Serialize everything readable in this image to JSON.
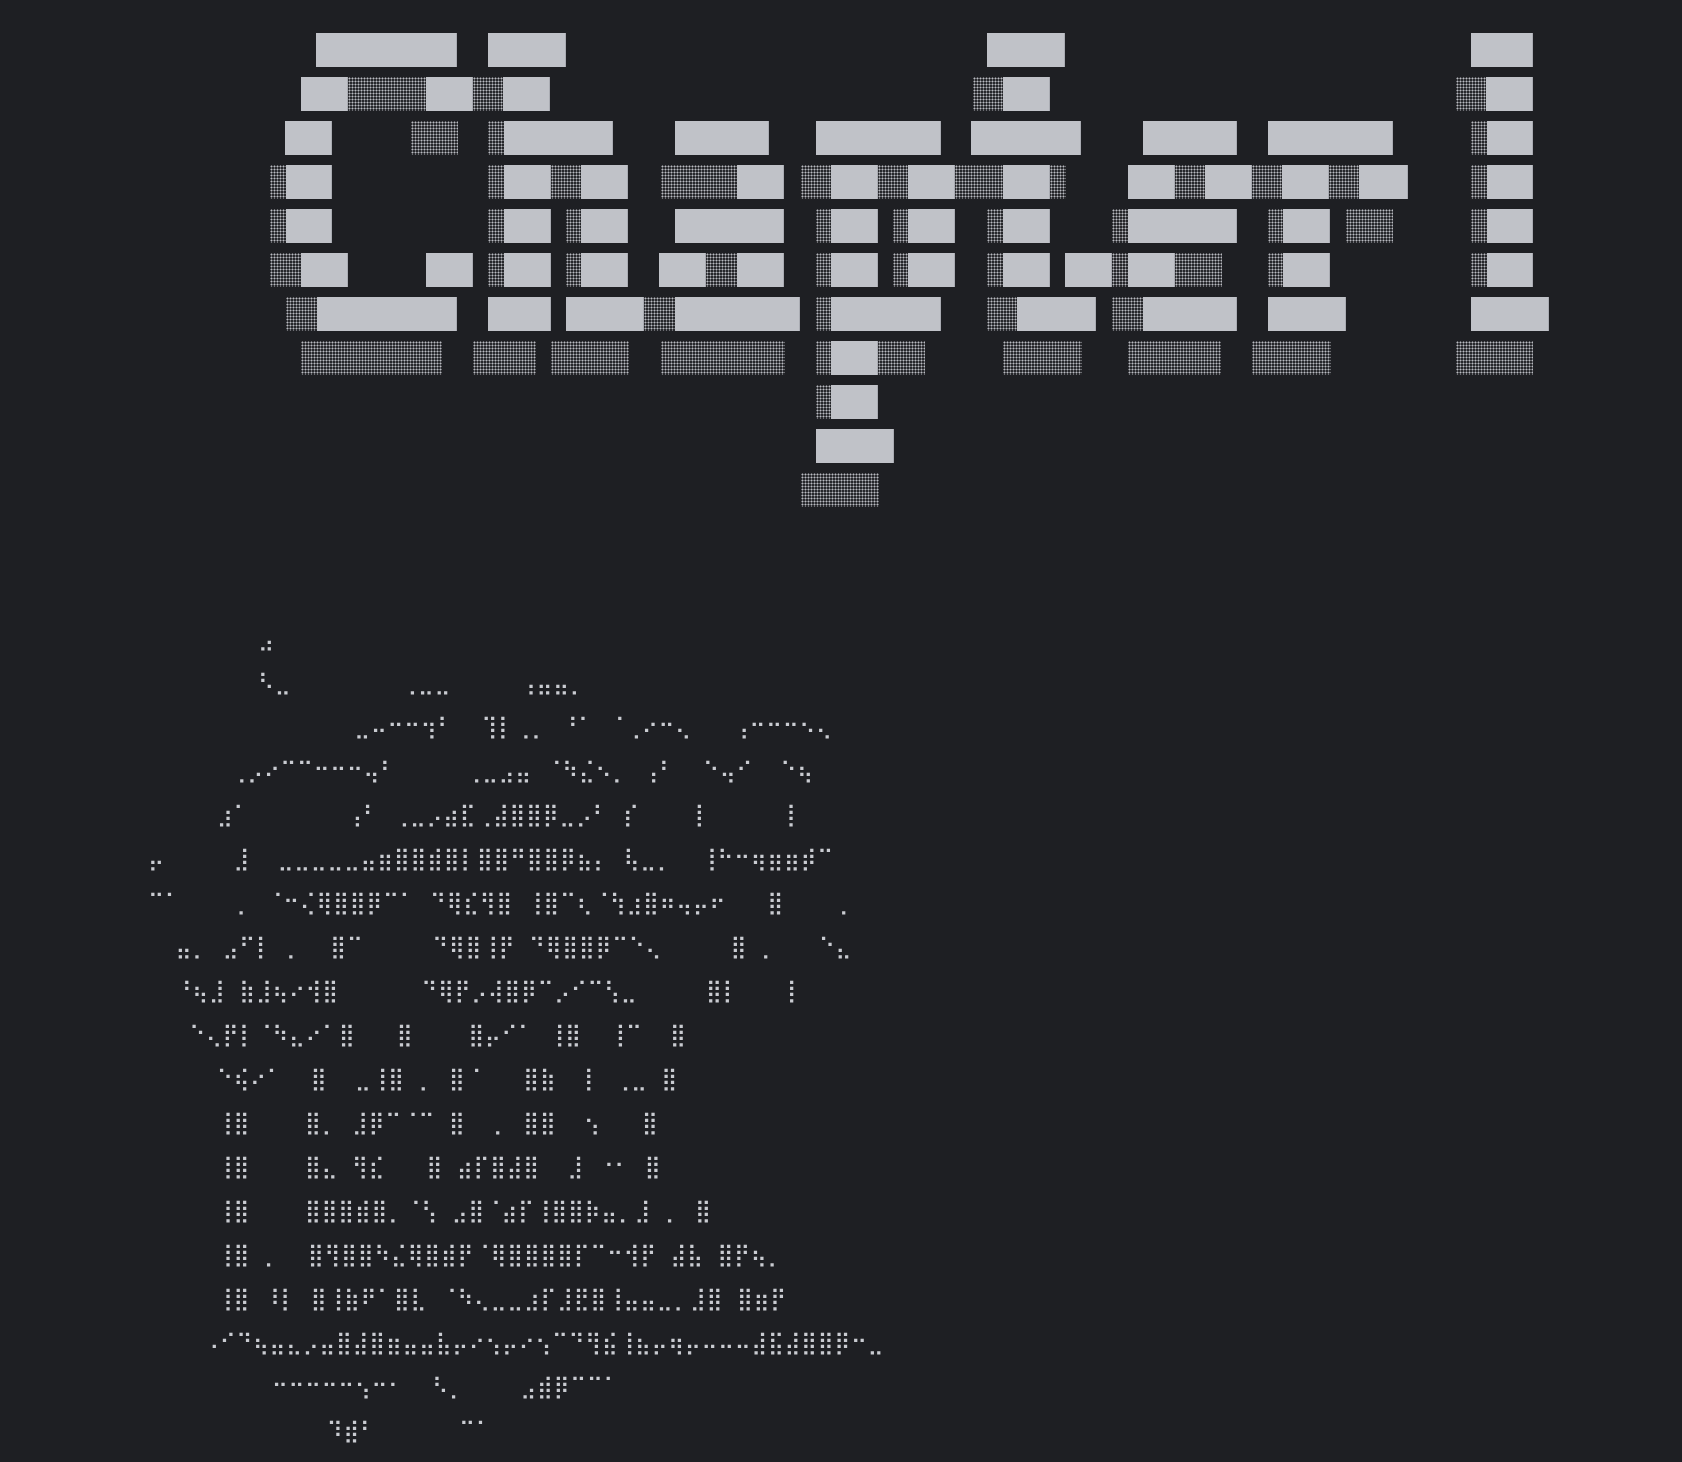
{
  "terminal": {
    "background": "#1e1f23",
    "foreground": "#c9cbd1"
  },
  "logo": {
    "text": "Clojure",
    "style": "block-shadow ascii banner",
    "block_color": "#c0c2c8",
    "shadow_color": "#b9bbc1"
  },
  "art": {
    "lines": [
      "        ⣠",
      "        ⠣⣀        ⢀⣀⣀     ⢠⣤⣤⡀",
      "               ⣀⠤⠒⠒⢲⠃  ⢹⡇⢀⡀ ⠘⠁ ⠈⢀⠔⠒⢄   ⢠⠒⠒⠒⠢⢄",
      "      ⢀⡠⠔⠉⠉⠒⠒⠒⢤⠃     ⢀⣀⣠⣤ ⠈⠳⣌⠢⡀ ⢠⠃  ⠑⢤⠊  ⠑⢦",
      "     ⣰⠁       ⢠⠃ ⢀⣀⡠⣴⣏⢀⣼⣿⣿⡿⣀⡠⠃ ⡎    ⡇     ⢸",
      "⡤     ⣸  ⣀⣀⣀⣀⣀⣤⣶⣿⣿⣾⣿⡇⣿⣿⠛⣿⣿⡿⣦⡄ ⢧⣀⡀  ⢸⠓⠒⢶⣶⣶⡾⠉",
      "⠉⠁    ⡀ ⠈⠒⢌⢿⣿⣿⡿⠉⠁ ⠙⢿⣎⢻⣿ ⢸⣿⠉⢆⠈⢳⣰⣿⠶⢤⡤⠖   ⣿    ⡀",
      "  ⣤⡀ ⣠⠋⡇ ⡀  ⣿⠉     ⠙⢿⣿⢸⡟ ⠙⢿⣿⣿⡿⠉⠑⢄     ⣿ ⡀   ⠑⣄",
      "  ⠘⢦⣸ ⣷⣸⢦⠔⢺⣿      ⠙⢿⡟⡠⢼⣿⡿⠉⡠⠊⠉⢣⣀     ⣿⡇   ⢸",
      "   ⠑⢄⡟⡇⠈⠳⣄⠔⠁⣿   ⣿    ⣿⡤⠊⠁ ⢸⣿  ⢸⠉  ⣿",
      "     ⠑⢮⠔⠁  ⣿  ⣀⢸⣿ ⡀ ⣿⠈   ⣿⣷  ⡇ ⢀⣀ ⣿",
      "     ⢸⣿    ⣿⡀ ⣸⡿⠉⠈⠉ ⣿  ⡀ ⣿⣿  ⢢   ⣿",
      "     ⢸⣿    ⣿⣄ ⢻⣎   ⣿ ⣴⡏⣿⣼⣿  ⣸ ⠐⠂ ⣿",
      "     ⢸⣿    ⣿⣿⣿⣾⣿⡀⠈⢣ ⣠⣿⠈⣴⡏⢸⣿⣿⡷⣤⡀⣸ ⡀ ⣿",
      "     ⢸⣿ ⡀  ⣿⢻⣿⣿⠳⣌⢿⣿⣾⡟⠈⢿⣿⣿⣿⣿⡏⠉⠒⢺⡟ ⣼⣧ ⣿⡟⢦⡀",
      "     ⢸⣿ ⠸⡇ ⣿⢸⣷⠟⠁⣿⣇ ⠈⠳⢄⣀⣀⣰⡏⣸⣟⣿⢸⣤⣤⣀⡀⣸⣿ ⣿⣶⡟",
      "    ⠠⠊⠙⢦⣤⣄⡠⣤⣿⣼⣿⣶⣤⣤⣧⡤⠔⢢⡤⠔⢢⠉⠙⢻⣮⢸⣦⡤⢶⡤⠤⠤⠤⣼⣯⣼⣿⣿⡿⠒⣀",
      "         ⠒⠒⠒⠒⠒⢢⠒⠂  ⠣⡀    ⣠⣾⡿⠉⠉⠁",
      "             ⠹⣾⠃      ⠉⠁"
    ]
  }
}
